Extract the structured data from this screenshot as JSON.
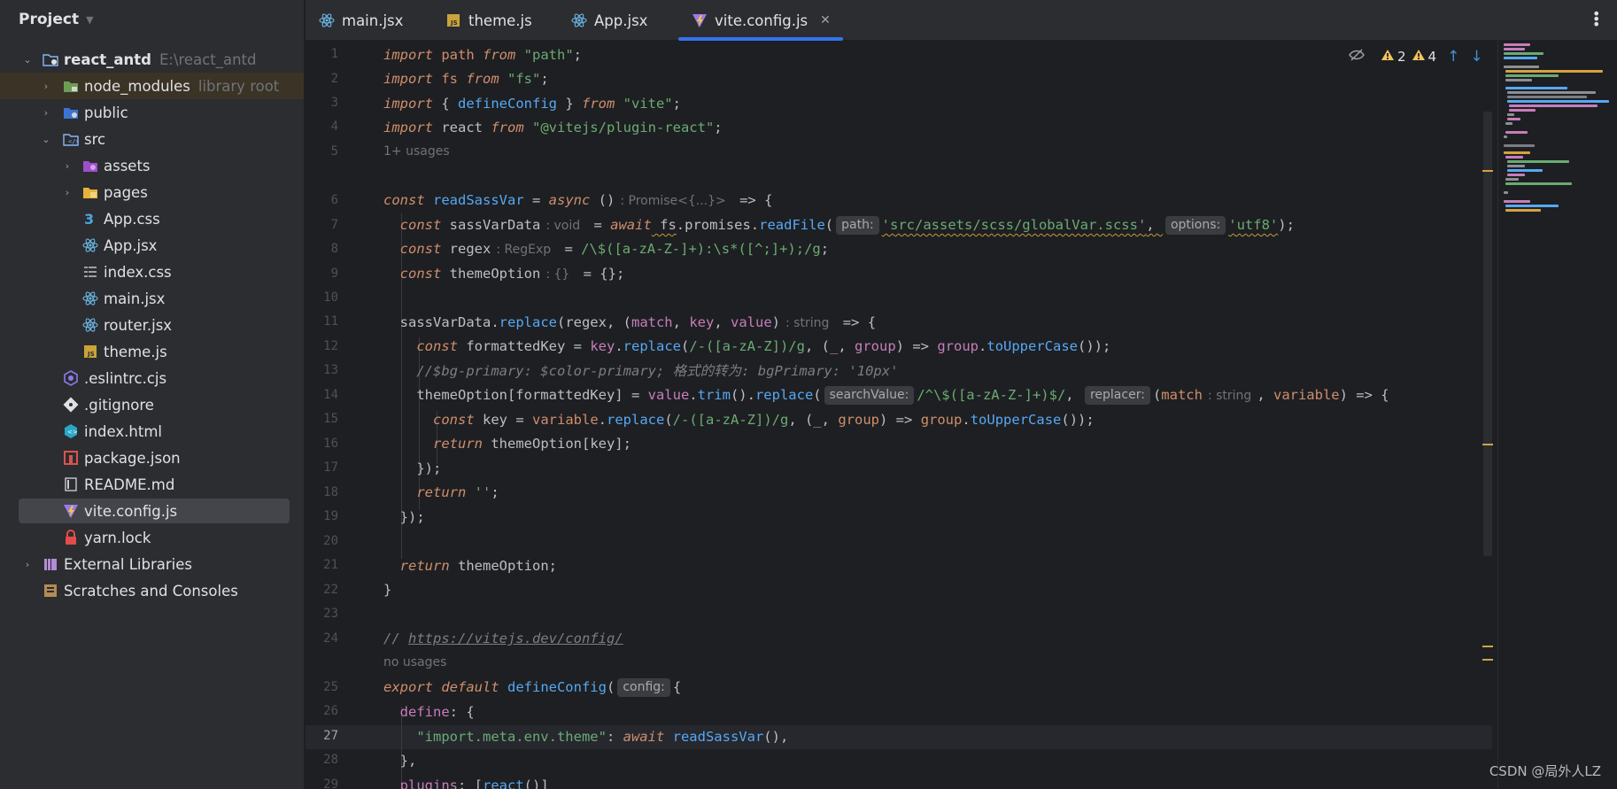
{
  "project": {
    "title": "Project"
  },
  "tree": {
    "root": {
      "label": "react_antd",
      "path": "E:\\react_antd"
    },
    "node_modules": {
      "label": "node_modules",
      "meta": "library root"
    },
    "public": {
      "label": "public"
    },
    "src": {
      "label": "src"
    },
    "assets": {
      "label": "assets"
    },
    "pages": {
      "label": "pages"
    },
    "app_css": {
      "label": "App.css"
    },
    "app_jsx": {
      "label": "App.jsx"
    },
    "index_css": {
      "label": "index.css"
    },
    "main_jsx": {
      "label": "main.jsx"
    },
    "router_jsx": {
      "label": "router.jsx"
    },
    "theme_js": {
      "label": "theme.js"
    },
    "eslintrc": {
      "label": ".eslintrc.cjs"
    },
    "gitignore": {
      "label": ".gitignore"
    },
    "index_html": {
      "label": "index.html"
    },
    "package_json": {
      "label": "package.json"
    },
    "readme": {
      "label": "README.md"
    },
    "vite_config": {
      "label": "vite.config.js"
    },
    "yarn_lock": {
      "label": "yarn.lock"
    },
    "external": {
      "label": "External Libraries"
    },
    "scratches": {
      "label": "Scratches and Consoles"
    }
  },
  "tabs": [
    {
      "label": "main.jsx"
    },
    {
      "label": "theme.js"
    },
    {
      "label": "App.jsx"
    },
    {
      "label": "vite.config.js"
    }
  ],
  "inspections": {
    "warn_a": "2",
    "warn_b": "4"
  },
  "hints": {
    "usages_1": "1+ usages",
    "usages_2": "no usages",
    "t_promise": ": Promise<{...}>",
    "t_void": ": void",
    "t_regexp": ": RegExp",
    "t_obj": ": {}",
    "t_string": ": string",
    "p_path": "path:",
    "p_options": "options:",
    "p_search": "searchValue:",
    "p_replacer": "replacer:",
    "p_config": "config:"
  },
  "code": {
    "l1a": "import",
    "l1b": " path ",
    "l1c": "from",
    "l1d": " \"path\"",
    "l1e": ";",
    "l2a": "import",
    "l2b": " fs ",
    "l2c": "from",
    "l2d": " \"fs\"",
    "l2e": ";",
    "l3a": "import",
    "l3b": " { ",
    "l3c": "defineConfig",
    "l3d": " } ",
    "l3e": "from",
    "l3f": " \"vite\"",
    "l3g": ";",
    "l4a": "import",
    "l4b": " react ",
    "l4c": "from",
    "l4d": " \"@vitejs/plugin-react\"",
    "l4e": ";",
    "l6a": "const",
    "l6b": " readSassVar",
    "l6c": " = ",
    "l6d": "async",
    "l6e": " ()",
    "l6g": " => {",
    "l7a": "const",
    "l7b": " sassVarData",
    "l7d": " = ",
    "l7e": "await",
    "l7f": " fs",
    "l7g": ".promises.",
    "l7h": "readFile",
    "l7i": "(",
    "l7k": "'src/assets/scss/globalVar.scss'",
    "l7l": ", ",
    "l7n": "'utf8'",
    "l7o": ");",
    "l8a": "const",
    "l8b": " regex",
    "l8d": " = ",
    "l8e": "/\\$([a-zA-Z-]+):\\s*([^;]+);/g",
    "l8f": ";",
    "l9a": "const",
    "l9b": " themeOption",
    "l9d": " = {};",
    "l11a": "sassVarData.",
    "l11b": "replace",
    "l11c": "(regex, (",
    "l11d": "match",
    "l11e": ", ",
    "l11f": "key",
    "l11g": ", ",
    "l11h": "value",
    "l11i": ")",
    "l11k": " => {",
    "l12a": "const",
    "l12b": " formattedKey = ",
    "l12c": "key",
    "l12d": ".",
    "l12e": "replace",
    "l12f": "(",
    "l12g": "/-([a-zA-Z])/g",
    "l12h": ", (",
    "l12i": "_",
    "l12j": ", ",
    "l12k": "group",
    "l12l": ") => ",
    "l12m": "group",
    "l12n": ".",
    "l12o": "toUpperCase",
    "l12p": "());",
    "l13": "//$bg-primary: $color-primary; 格式的转为: bgPrimary: '10px'",
    "l14a": "themeOption[formattedKey] = ",
    "l14b": "value",
    "l14c": ".",
    "l14d": "trim",
    "l14e": "().",
    "l14f": "replace",
    "l14g": "(",
    "l14i": "/^\\$([a-zA-Z-]+)$/",
    "l14j": ", ",
    "l14l": "(",
    "l14m": "match",
    "l14o": ", ",
    "l14p": "variable",
    "l14q": ") => {",
    "l15a": "const",
    "l15b": " key = ",
    "l15c": "variable",
    "l15d": ".",
    "l15e": "replace",
    "l15f": "(",
    "l15g": "/-([a-zA-Z])/g",
    "l15h": ", (",
    "l15i": "_",
    "l15j": ", ",
    "l15k": "group",
    "l15l": ") => ",
    "l15m": "group",
    "l15n": ".",
    "l15o": "toUpperCase",
    "l15p": "());",
    "l16a": "return",
    "l16b": " themeOption[key];",
    "l17": "});",
    "l18a": "return",
    "l18b": " ''",
    "l18c": ";",
    "l19": "});",
    "l21a": "return",
    "l21b": " themeOption;",
    "l22": "}",
    "l24a": "// ",
    "l24b": "https://vitejs.dev/config/",
    "l25a": "export",
    "l25b": " default",
    "l25c": " defineConfig",
    "l25d": "(",
    "l25f": "{",
    "l26a": "define",
    "l26b": ": {",
    "l27a": "\"import.meta.env.theme\"",
    "l27b": ": ",
    "l27c": "await",
    "l27d": " readSassVar",
    "l27e": "(),",
    "l28": "},",
    "l29a": "plugins",
    "l29b": ": [",
    "l29c": "react",
    "l29d": "()]"
  },
  "watermark": "CSDN @局外人LZ",
  "colors": {
    "accent": "#3574f0",
    "keyword": "#cf8e6d",
    "string": "#6aab73",
    "function": "#56a8f5",
    "param": "#c77dbb",
    "warning": "#f2c55c"
  }
}
